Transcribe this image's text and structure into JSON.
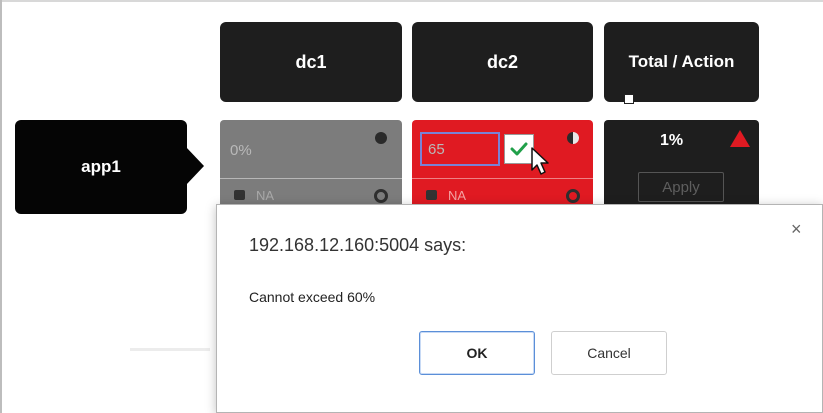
{
  "columns": {
    "dc1": "dc1",
    "dc2": "dc2",
    "total": "Total / Action"
  },
  "app": {
    "name": "app1"
  },
  "cells": {
    "dc1": {
      "value": "0%",
      "status_icon": "dot-icon",
      "footer_value": "NA",
      "color": "#7c7c7c"
    },
    "dc2": {
      "input_value": "65",
      "status_icon": "half-dot-icon",
      "footer_value": "NA",
      "color": "#e01a22"
    },
    "total": {
      "value": "1%",
      "warning_icon": "warning-triangle-icon",
      "apply_label": "Apply",
      "color": "#1e1e1e"
    }
  },
  "dialog": {
    "title": "192.168.12.160:5004 says:",
    "message": "Cannot exceed 60%",
    "ok_label": "OK",
    "cancel_label": "Cancel",
    "close_glyph": "×"
  }
}
